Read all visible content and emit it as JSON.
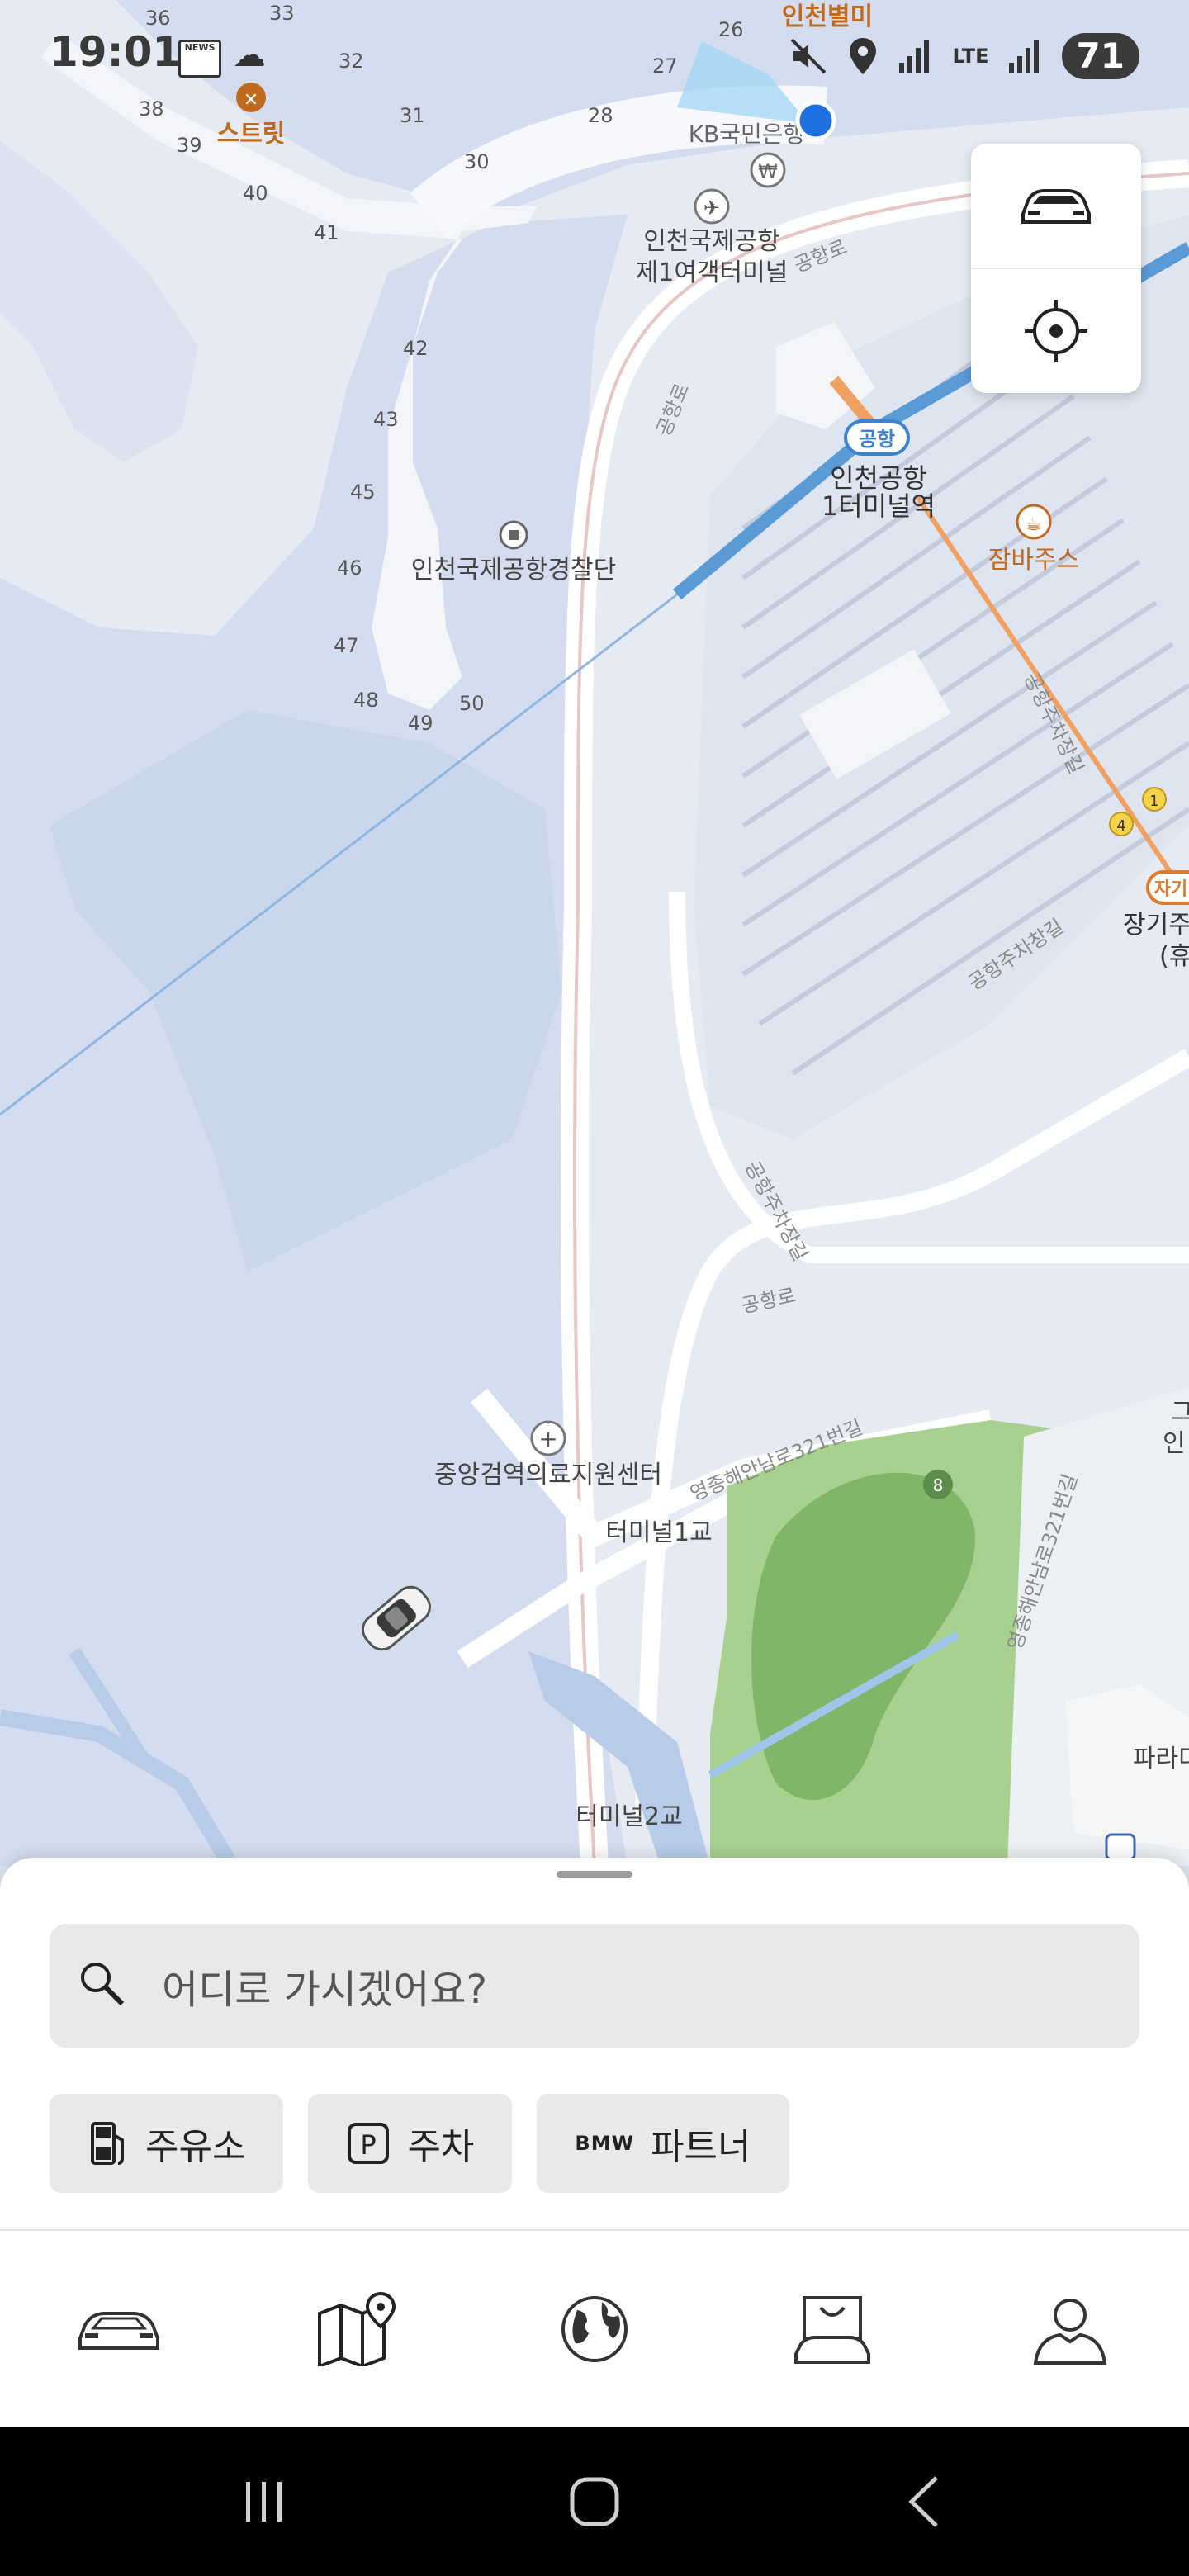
{
  "status_bar": {
    "time": "19:01",
    "network": "LTE",
    "battery": "71"
  },
  "map": {
    "places": {
      "airport_terminal_1": {
        "line1": "인천국제공항",
        "line2": "제1여객터미널"
      },
      "airport_station_badge": "공항",
      "airport_station": {
        "line1": "인천공항",
        "line2": "1터미널역"
      },
      "kb_bank": "KB국민은행",
      "star_avenue": "인천별미",
      "street": "스트릿",
      "police": "인천국제공항경찰단",
      "jamba": "잠바주스",
      "long_term_parking": {
        "line1": "장기주",
        "line2": "(휴"
      },
      "long_term_badge": "자기",
      "medical": "중앙검역의료지원센터",
      "bridge1": "터미널1교",
      "bridge2": "터미널2교",
      "paradise": "파라다",
      "right_edge_1": "그",
      "right_edge_2": "인"
    },
    "roads": {
      "airport_road_top": "공항로",
      "airport_road_left": "공항로",
      "airport_road_bottom": "공항로",
      "parking_road_1": "공항주차장길",
      "parking_road_2": "공항주차창길",
      "parking_road_3": "공항주차장길",
      "yeongjong_1": "영종해안남로321번길",
      "yeongjong_2": "영종해안남로321번길"
    },
    "gates": [
      "26",
      "27",
      "28",
      "30",
      "31",
      "32",
      "33",
      "36",
      "38",
      "39",
      "40",
      "41",
      "42",
      "43",
      "45",
      "46",
      "47",
      "48",
      "49",
      "50"
    ],
    "route_badges": [
      "1",
      "4"
    ],
    "golf_marker": "8",
    "buttons": {
      "car_icon": "car-icon",
      "locate_icon": "crosshair-icon"
    }
  },
  "sheet": {
    "search_placeholder": "어디로 가시겠어요?",
    "chips": [
      {
        "icon": "fuel-pump-icon",
        "label": "주유소"
      },
      {
        "icon": "parking-icon",
        "label": "주차"
      },
      {
        "icon": "bmw-logo",
        "brand": "BMW",
        "label": "파트너"
      }
    ]
  },
  "bottom_nav": [
    {
      "name": "car",
      "icon": "car-icon"
    },
    {
      "name": "map",
      "icon": "map-pin-icon",
      "active": true
    },
    {
      "name": "explore",
      "icon": "globe-icon"
    },
    {
      "name": "shop",
      "icon": "shopping-car-icon"
    },
    {
      "name": "profile",
      "icon": "user-icon"
    }
  ],
  "colors": {
    "map_water": "#cfdaef",
    "map_land": "#e9edf4",
    "road": "#ffffff",
    "rail": "#5b9bd5",
    "golf": "#a7cf8c",
    "location_dot": "#1e6fe0",
    "label": "#333333",
    "orange": "#c06a1e"
  }
}
